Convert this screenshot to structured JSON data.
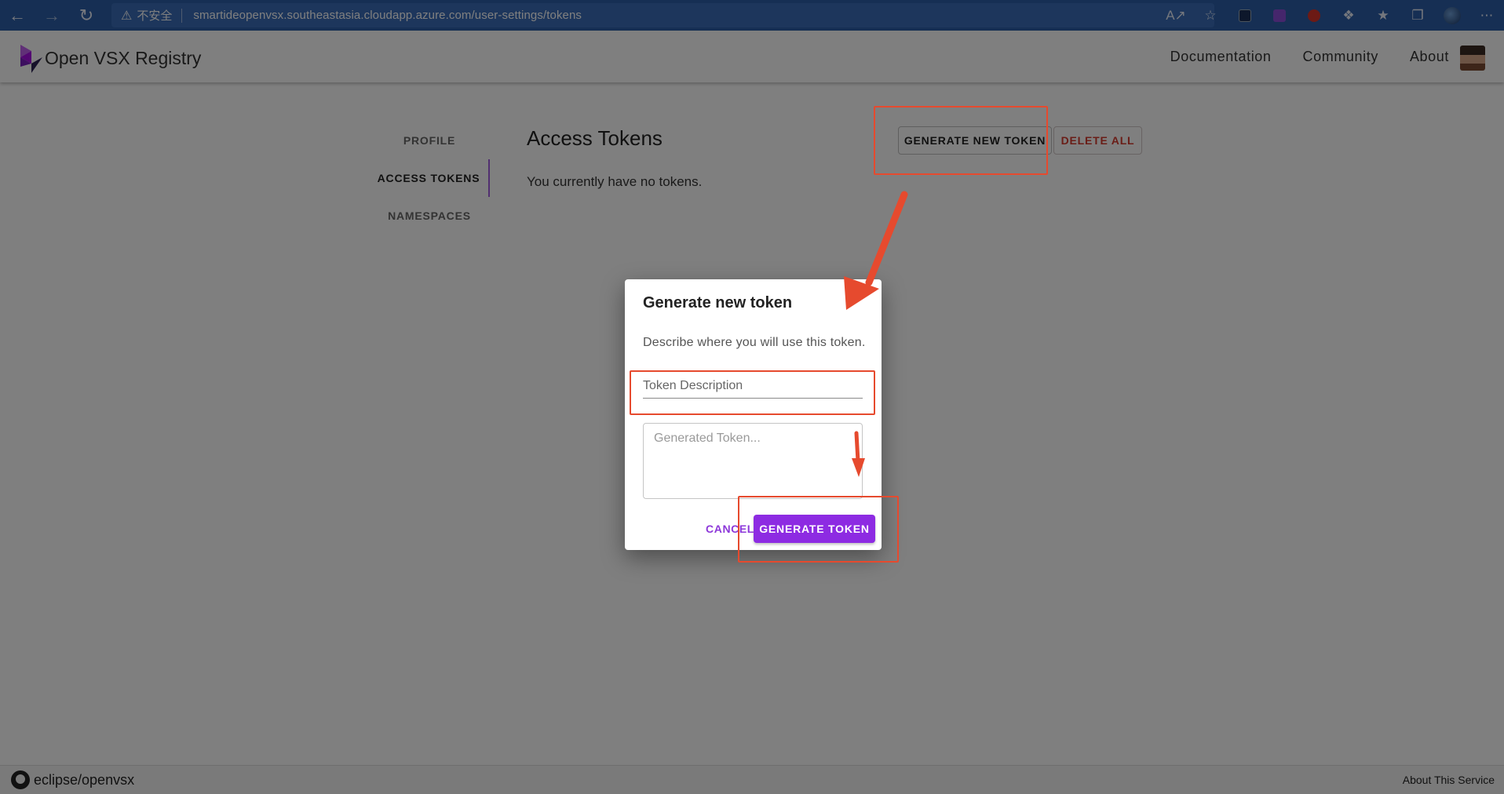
{
  "browser": {
    "security_label": "不安全",
    "url": "smartideopenvsx.southeastasia.cloudapp.azure.com/user-settings/tokens",
    "nav_icons": [
      "back-arrow-icon",
      "forward-arrow-icon",
      "reload-icon"
    ],
    "toolbar_icons": [
      "read-aloud-icon",
      "add-favorite-icon",
      "extension-arrow-icon",
      "extension-purple-icon",
      "extension-red-icon",
      "extensions-puzzle-icon",
      "favorites-icon",
      "collections-icon",
      "profile-avatar-icon",
      "more-menu-icon"
    ]
  },
  "header": {
    "logo_text": "Open VSX Registry",
    "nav": [
      "Documentation",
      "Community",
      "About"
    ]
  },
  "settings": {
    "nav": [
      "PROFILE",
      "ACCESS TOKENS",
      "NAMESPACES"
    ],
    "active": "ACCESS TOKENS",
    "title": "Access Tokens",
    "empty_text": "You currently have no tokens.",
    "generate_new_label": "GENERATE NEW TOKEN",
    "delete_all_label": "DELETE ALL"
  },
  "dialog": {
    "title": "Generate new token",
    "description": "Describe where you will use this token.",
    "token_description_placeholder": "Token Description",
    "generated_token_placeholder": "Generated Token...",
    "cancel_label": "CANCEL",
    "generate_label": "GENERATE TOKEN"
  },
  "footer": {
    "repo": "eclipse/openvsx",
    "about_service": "About This Service"
  },
  "colors": {
    "browser_bar": "#2d5fa8",
    "accent_purple": "#8d2be2",
    "delete_red": "#d53a2f",
    "annotation": "#e64a2e"
  }
}
